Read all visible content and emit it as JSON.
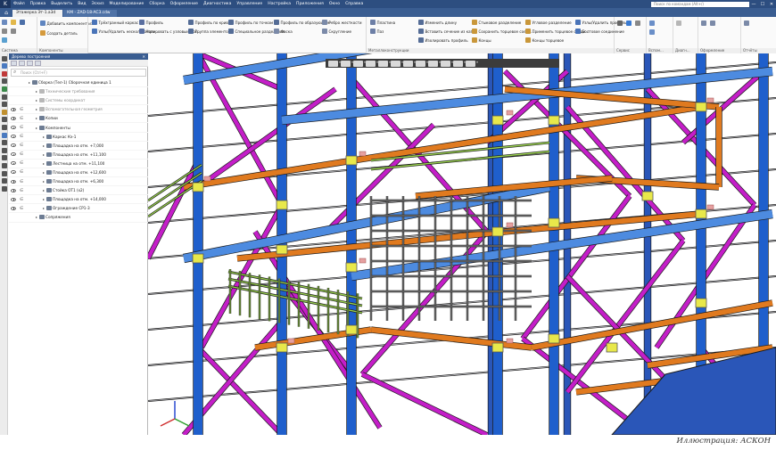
{
  "menubar": {
    "items": [
      "Файл",
      "Правка",
      "Выделить",
      "Вид",
      "Эскиз",
      "Моделирование",
      "Сборка",
      "Оформление",
      "Диагностика",
      "Управление",
      "Настройка",
      "Приложения",
      "Окно",
      "Справка"
    ],
    "search_placeholder": "Поиск по командам (Alt+/)",
    "window_buttons": [
      "—",
      "☐",
      "✕"
    ]
  },
  "tabs": [
    "Этажерка Эт-1.a3d",
    "КМ - ZAD-18-AC3.cdw"
  ],
  "ribbon": {
    "groups": [
      {
        "label": "Система",
        "buttons": []
      },
      {
        "label": "Компоненты",
        "buttons": [
          "Добавить компонент из...",
          "Создать деталь"
        ]
      },
      {
        "label": "",
        "buttons": [
          "Трёхгранный каркас",
          "Узлы/Удалить несколько про...",
          "Профиль",
          "Копировать с узловым пол...",
          "Профиль по кривой",
          "Группа элементов",
          "Профиль по точкам",
          "Специальное разделение",
          "Профиль по образующим",
          "Фаска",
          "Ребро жесткости",
          "Скругление",
          "Пластина",
          "Паз"
        ]
      },
      {
        "label": "Металлоконструкции",
        "buttons": [
          "Изменить длину",
          "Вставить сечение из кат...",
          "Изолировать профиль",
          "Стыковое разделение",
          "Сохранить торцевое соеди...",
          "Концы",
          "Угловое разделение",
          "Применить торцевое соеди...",
          "Концы торцевое",
          "Узлы/Удалить профиль",
          "Болтовое соединение"
        ]
      },
      {
        "label": "Сервис",
        "buttons": []
      },
      {
        "label": "Вспом...",
        "buttons": []
      },
      {
        "label": "Диагн...",
        "buttons": []
      },
      {
        "label": "Оформление",
        "buttons": []
      },
      {
        "label": "Отчёты",
        "buttons": []
      }
    ]
  },
  "panel": {
    "title": "Дерево построения",
    "search_placeholder": "Поиск (Ctrl+F)",
    "tree": [
      {
        "label": "Сборка (Тел-1) Сборочная единица 1",
        "level": 0,
        "grey": false,
        "eye": false
      },
      {
        "label": "Технические требования",
        "level": 1,
        "grey": true,
        "eye": false
      },
      {
        "label": "Системы координат",
        "level": 1,
        "grey": true,
        "eye": false
      },
      {
        "label": "Вспомогательная геометрия",
        "level": 1,
        "grey": true,
        "eye": true
      },
      {
        "label": "Копии",
        "level": 1,
        "grey": false,
        "eye": true
      },
      {
        "label": "Компоненты",
        "level": 1,
        "grey": false,
        "eye": true
      },
      {
        "label": "Каркас Кэ-1",
        "level": 2,
        "grey": false,
        "eye": true
      },
      {
        "label": "Площадка на отм. +7,000",
        "level": 2,
        "grey": false,
        "eye": true
      },
      {
        "label": "Площадка на отм. +11,100",
        "level": 2,
        "grey": false,
        "eye": true
      },
      {
        "label": "Лестница на отм. +11,100",
        "level": 2,
        "grey": false,
        "eye": true
      },
      {
        "label": "Площадка на отм. +12,600",
        "level": 2,
        "grey": false,
        "eye": true
      },
      {
        "label": "Площадка на отм. +6,300",
        "level": 2,
        "grey": false,
        "eye": true
      },
      {
        "label": "Стойка ОТ1 (x2)",
        "level": 2,
        "grey": false,
        "eye": true
      },
      {
        "label": "Площадка на отм. +14,000",
        "level": 2,
        "grey": false,
        "eye": true
      },
      {
        "label": "Ограждение СР1-3",
        "level": 2,
        "grey": false,
        "eye": true
      },
      {
        "label": "Сопряжения",
        "level": 1,
        "grey": false,
        "eye": false
      }
    ]
  },
  "colors": {
    "column": "#1f5fcc",
    "brace": "#c41ec8",
    "beam": "#e07a1f",
    "plate": "#e8e84a",
    "rail": "#9ad34e",
    "bolt": "#e6a0a0"
  },
  "credit": "Иллюстрация: АСКОН"
}
